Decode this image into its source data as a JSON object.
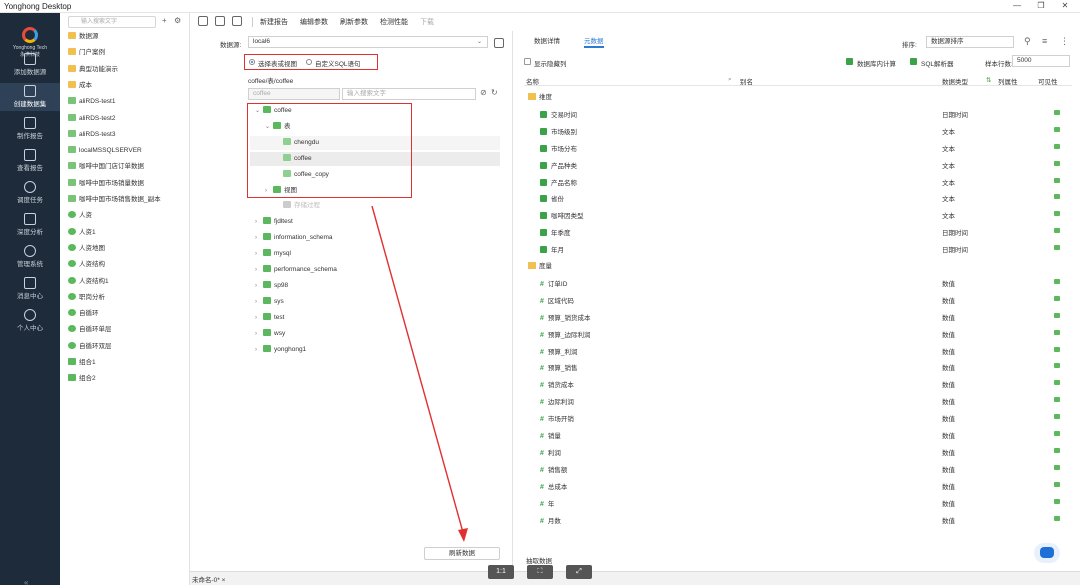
{
  "window": {
    "title": "Yonghong Desktop",
    "minimize": "—",
    "maximize": "❐",
    "close": "✕"
  },
  "nav": {
    "logo_line1": "Yonghong Tech",
    "logo_line2": "永洪科技",
    "items": [
      {
        "label": "添加数据源"
      },
      {
        "label": "创建数据集"
      },
      {
        "label": "制作报告"
      },
      {
        "label": "查看报告"
      },
      {
        "label": "调度任务"
      },
      {
        "label": "深度分析"
      },
      {
        "label": "管理系统"
      },
      {
        "label": "消息中心"
      },
      {
        "label": "个人中心"
      }
    ],
    "collapse": "«"
  },
  "tree": {
    "search_placeholder": "输入搜索文字",
    "items": [
      {
        "label": "数据源",
        "icon": "folder"
      },
      {
        "label": "门户案例",
        "icon": "folder"
      },
      {
        "label": "典型功能演示",
        "icon": "folder"
      },
      {
        "label": "成本",
        "icon": "folder"
      },
      {
        "label": "aliRDS-test1",
        "icon": "table"
      },
      {
        "label": "aliRDS-test2",
        "icon": "table"
      },
      {
        "label": "aliRDS-test3",
        "icon": "table"
      },
      {
        "label": "localMSSQLSERVER",
        "icon": "table"
      },
      {
        "label": "咖啡中国门店订单数据",
        "icon": "table"
      },
      {
        "label": "咖啡中国市场销量数据",
        "icon": "table"
      },
      {
        "label": "咖啡中国市场销售数据_副本",
        "icon": "table"
      },
      {
        "label": "人资",
        "icon": "circle"
      },
      {
        "label": "人资1",
        "icon": "circle"
      },
      {
        "label": "人资地图",
        "icon": "circle"
      },
      {
        "label": "人资结构",
        "icon": "circle"
      },
      {
        "label": "人资结构1",
        "icon": "circle"
      },
      {
        "label": "职岗分析",
        "icon": "circle"
      },
      {
        "label": "自循环",
        "icon": "circle"
      },
      {
        "label": "自循环单层",
        "icon": "circle"
      },
      {
        "label": "自循环双层",
        "icon": "circle"
      },
      {
        "label": "组合1",
        "icon": "toggle"
      },
      {
        "label": "组合2",
        "icon": "toggle"
      }
    ]
  },
  "toolbar": {
    "new_report": "新建报告",
    "edit_params": "编辑参数",
    "refresh_params": "刷新参数",
    "check_perf": "检测性能",
    "download": "下载"
  },
  "center": {
    "datasource_label": "数据源:",
    "datasource_value": "local6",
    "radio_table": "选择表或视图",
    "radio_sql": "自定义SQL语句",
    "path": "coffee/表/coffee",
    "filter_value": "coffee",
    "filter_placeholder": "输入搜索文字",
    "db_tree": [
      {
        "label": "coffee",
        "depth": 0,
        "expanded": true
      },
      {
        "label": "表",
        "depth": 1,
        "expanded": true
      },
      {
        "label": "chengdu",
        "depth": 2
      },
      {
        "label": "coffee",
        "depth": 2,
        "selected": true
      },
      {
        "label": "coffee_copy",
        "depth": 2
      },
      {
        "label": "视图",
        "depth": 1
      },
      {
        "label": "存储过程",
        "depth": 2,
        "dim": true
      },
      {
        "label": "fjdltest",
        "depth": 0
      },
      {
        "label": "information_schema",
        "depth": 0
      },
      {
        "label": "mysql",
        "depth": 0
      },
      {
        "label": "performance_schema",
        "depth": 0
      },
      {
        "label": "sp98",
        "depth": 0
      },
      {
        "label": "sys",
        "depth": 0
      },
      {
        "label": "test",
        "depth": 0
      },
      {
        "label": "wsy",
        "depth": 0
      },
      {
        "label": "yonghong1",
        "depth": 0
      }
    ],
    "refresh_button": "刷新数据"
  },
  "right": {
    "tabs": [
      "数据详情",
      "元数据"
    ],
    "active_tab": 1,
    "sort_label": "排序:",
    "sort_value": "数据源排序",
    "show_hidden": "显示隐藏列",
    "db_calc": "数据库内计算",
    "sql_parser": "SQL解析器",
    "sample_rows_label": "样本行数:",
    "sample_rows_value": "5000",
    "columns": {
      "name": "名称",
      "alias": "别名",
      "type": "数据类型",
      "attr": "列属性",
      "visible": "可见性"
    },
    "dimension_group": "维度",
    "measure_group": "度量",
    "dimensions": [
      {
        "name": "交易时间",
        "type": "日期时间"
      },
      {
        "name": "市场级别",
        "type": "文本"
      },
      {
        "name": "市场分布",
        "type": "文本"
      },
      {
        "name": "产品种类",
        "type": "文本"
      },
      {
        "name": "产品名称",
        "type": "文本"
      },
      {
        "name": "省份",
        "type": "文本"
      },
      {
        "name": "咖啡因类型",
        "type": "文本"
      },
      {
        "name": "年季度",
        "type": "日期时间"
      },
      {
        "name": "年月",
        "type": "日期时间"
      }
    ],
    "measures": [
      {
        "name": "订单ID",
        "type": "数值"
      },
      {
        "name": "区域代码",
        "type": "数值"
      },
      {
        "name": "预算_销货成本",
        "type": "数值"
      },
      {
        "name": "预算_边际利润",
        "type": "数值"
      },
      {
        "name": "预算_利润",
        "type": "数值"
      },
      {
        "name": "预算_销售",
        "type": "数值"
      },
      {
        "name": "销货成本",
        "type": "数值"
      },
      {
        "name": "边际利润",
        "type": "数值"
      },
      {
        "name": "市场开销",
        "type": "数值"
      },
      {
        "name": "销量",
        "type": "数值"
      },
      {
        "name": "利润",
        "type": "数值"
      },
      {
        "name": "销售额",
        "type": "数值"
      },
      {
        "name": "总成本",
        "type": "数值"
      },
      {
        "name": "年",
        "type": "数值"
      },
      {
        "name": "月数",
        "type": "数值"
      }
    ],
    "extract_label": "抽取数据"
  },
  "bottom": {
    "tab": "未命名-0*",
    "tab_close": "×",
    "btn1": "1:1",
    "btn2": "⛶",
    "btn3": "⤢"
  }
}
